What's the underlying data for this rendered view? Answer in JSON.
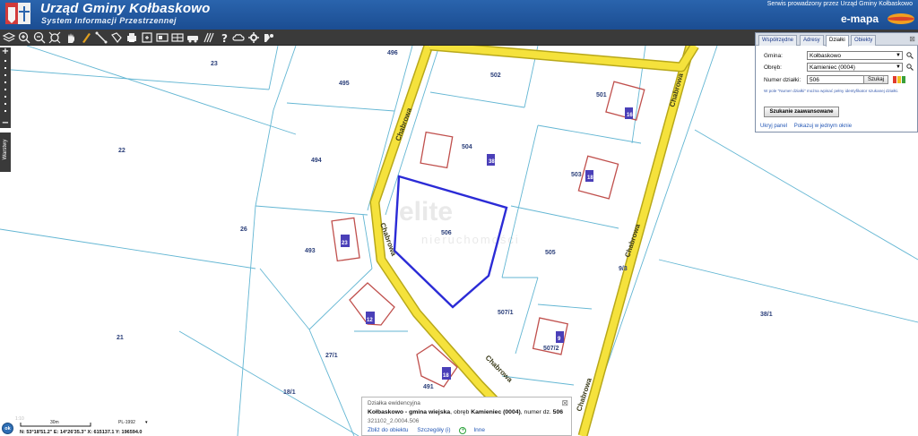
{
  "header": {
    "title": "Urząd Gminy Kołbaskowo",
    "subtitle": "System Informacji Przestrzennej",
    "serwis": "Serwis prowadzony przez Urząd Gminy Kołbaskowo",
    "emapa": "e-mapa"
  },
  "toolbar": {
    "icons": [
      "layers-icon",
      "zoom-in-icon",
      "zoom-out-icon",
      "zoom-extent-icon",
      "pan-hand-icon",
      "select-arrow-icon",
      "measure-line-icon",
      "measure-area-icon",
      "print-icon",
      "export-icon",
      "screen-icon",
      "car-icon",
      "hatch-icon",
      "help-icon",
      "cloud-icon",
      "gear-icon",
      "settings-pin-icon"
    ]
  },
  "panel": {
    "tabs": [
      "Współrzędne",
      "Adresy",
      "Działki",
      "Obiekty"
    ],
    "active_tab": "Działki",
    "gmina_label": "Gmina:",
    "gmina_value": "Kołbaskowo",
    "obreb_label": "Obręb:",
    "obreb_value": "Kamieniec (0004)",
    "numer_label": "Numer działki:",
    "numer_value": "506",
    "szukaj": "Szukaj",
    "hint": "W pole \"Numer działki\" można wpisać pełny identyfikator szukanej działki.",
    "advanced": "Szukanie zaawansowane",
    "hide_panel": "Ukryj panel",
    "show_window": "Pokazuj w jednym oknie"
  },
  "map": {
    "parcels": [
      "23",
      "496",
      "502",
      "495",
      "501",
      "22",
      "504",
      "494",
      "503",
      "506",
      "26",
      "493",
      "505",
      "21",
      "507/1",
      "27/1",
      "507/2",
      "491",
      "18/1",
      "38/1"
    ],
    "houses": [
      "16",
      "38",
      "18",
      "23",
      "12",
      "9",
      "18"
    ],
    "roads": [
      "Chabrowa",
      "Chabrowa",
      "Chabrowa",
      "Chabrowa",
      "Chabrowa"
    ],
    "extra": [
      "9/3"
    ],
    "watermark": "elite nieruchomości",
    "colors": {
      "parcel_line": "#63b6d3",
      "road_fill": "#f5e23c",
      "road_edge": "#b8a81a",
      "building": "#c0504d",
      "selected": "#2b2bd6",
      "label": "#2b3f7a"
    }
  },
  "zoom": {
    "plus": "+",
    "minus": "−",
    "warstwy": "Warstwy"
  },
  "popup": {
    "title": "Działka ewidencyjna",
    "main_bold": "Kołbaskowo - gmina wiejska",
    "main_obreb_pre": ", obręb ",
    "main_obreb": "Kamieniec (0004)",
    "main_num_pre": ", numer dz. ",
    "main_num": "506",
    "id": "321102_2.0004.506",
    "links": [
      "Zbliż do obiektu",
      "Szczegóły (i)",
      "Inne"
    ]
  },
  "footer": {
    "scale": "30m",
    "projection": "PL-1992",
    "coords": "N: 53°18'51.2\"  E: 14°26'35.3\"  X: 615137.1  Y: 196594.0",
    "ok": "ok",
    "faint": "1:10"
  }
}
